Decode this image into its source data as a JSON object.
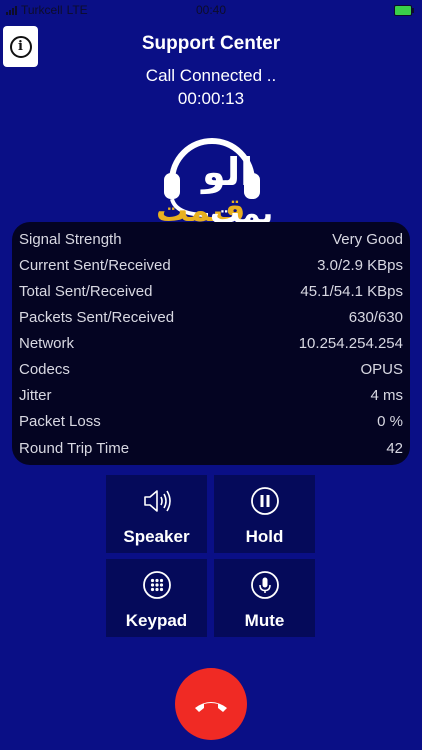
{
  "status_bar": {
    "carrier": "Turkcell",
    "network": "LTE",
    "time": "00:40"
  },
  "header": {
    "title": "Support Center",
    "call_status": "Call Connected ..",
    "timer": "00:00:13"
  },
  "stats": [
    {
      "label": "Signal Strength",
      "value": "Very Good"
    },
    {
      "label": "Current Sent/Received",
      "value": "3.0/2.9 KBps"
    },
    {
      "label": "Total Sent/Received",
      "value": "45.1/54.1 KBps"
    },
    {
      "label": "Packets Sent/Received",
      "value": "630/630"
    },
    {
      "label": "Network",
      "value": "10.254.254.254"
    },
    {
      "label": "Codecs",
      "value": "OPUS"
    },
    {
      "label": "Jitter",
      "value": "4 ms"
    },
    {
      "label": "Packet Loss",
      "value": "0 %"
    },
    {
      "label": "Round Trip Time",
      "value": "42"
    }
  ],
  "controls": {
    "speaker": {
      "label": "Speaker",
      "icon": "speaker-icon"
    },
    "hold": {
      "label": "Hold",
      "icon": "pause-icon"
    },
    "keypad": {
      "label": "Keypad",
      "icon": "keypad-icon"
    },
    "mute": {
      "label": "Mute",
      "icon": "microphone-icon"
    }
  },
  "end_call": {
    "icon": "hang-up-icon",
    "color": "#f02a24"
  },
  "colors": {
    "background": "#0a0f86",
    "panel": "#040422",
    "button": "#050a5a",
    "logo_accent": "#e8b020"
  }
}
